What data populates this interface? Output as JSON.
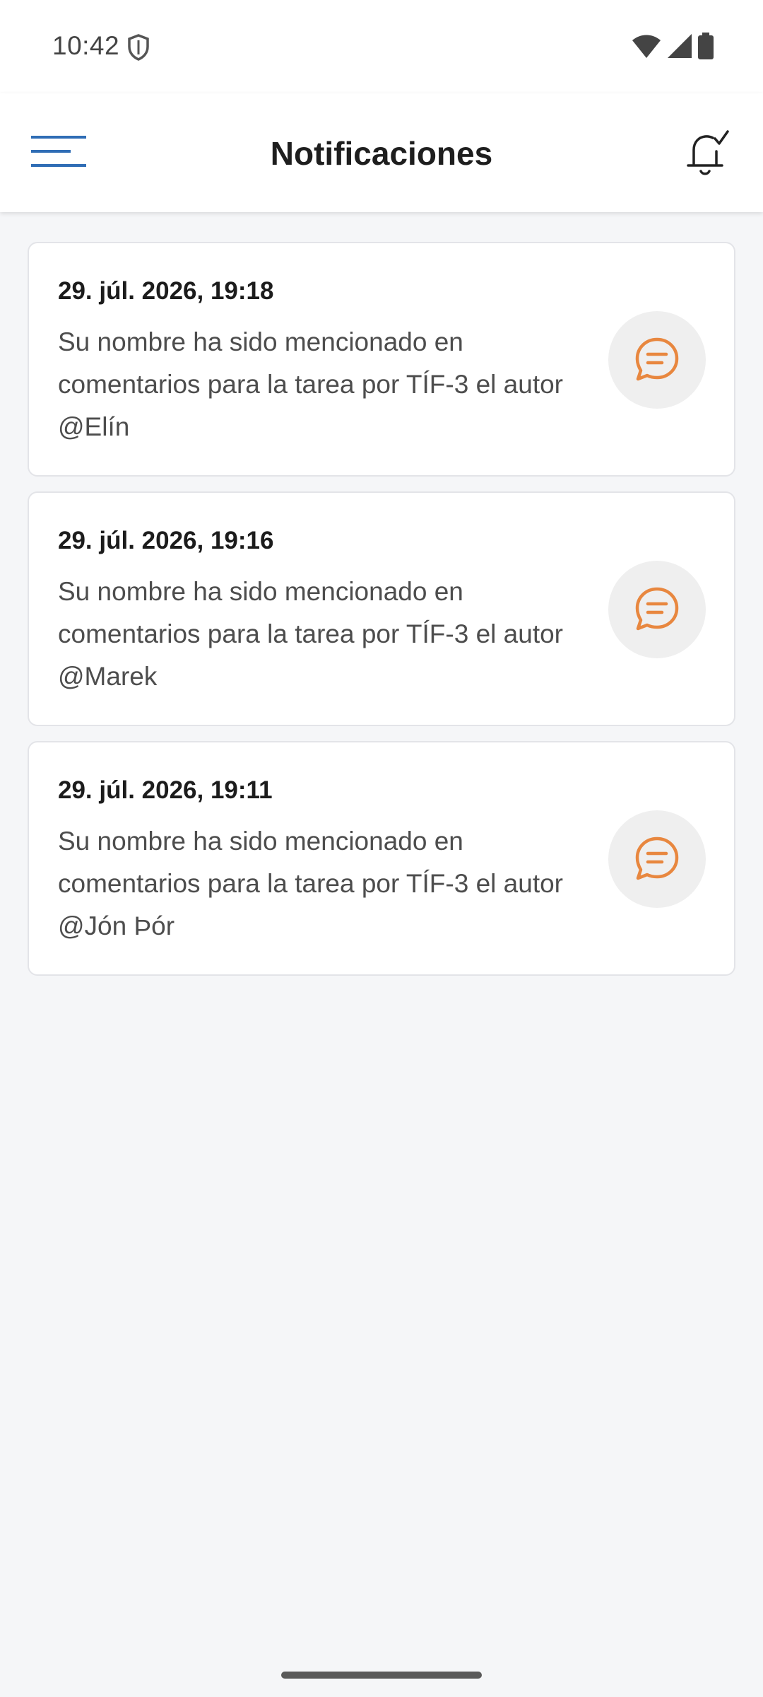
{
  "status_bar": {
    "time": "10:42",
    "icons": [
      "shield-icon",
      "wifi-icon",
      "signal-icon",
      "battery-icon"
    ]
  },
  "app_bar": {
    "title": "Notificaciones",
    "left_icon": "menu-icon",
    "right_icon": "bell-check-icon",
    "accent_color": "#2f6db5"
  },
  "notifications": [
    {
      "date": "29. júl. 2026, 19:18",
      "text": "Su nombre ha sido mencionado en comentarios para la tarea por TÍF-3 el autor @Elín",
      "icon": "comment-icon"
    },
    {
      "date": "29. júl. 2026, 19:16",
      "text": "Su nombre ha sido mencionado en comentarios para la tarea por TÍF-3 el autor @Marek",
      "icon": "comment-icon"
    },
    {
      "date": "29. júl. 2026, 19:11",
      "text": "Su nombre ha sido mencionado en comentarios para la tarea por TÍF-3 el autor @Jón Þór",
      "icon": "comment-icon"
    }
  ],
  "colors": {
    "icon_orange": "#e8873f",
    "background": "#f5f6f8"
  }
}
